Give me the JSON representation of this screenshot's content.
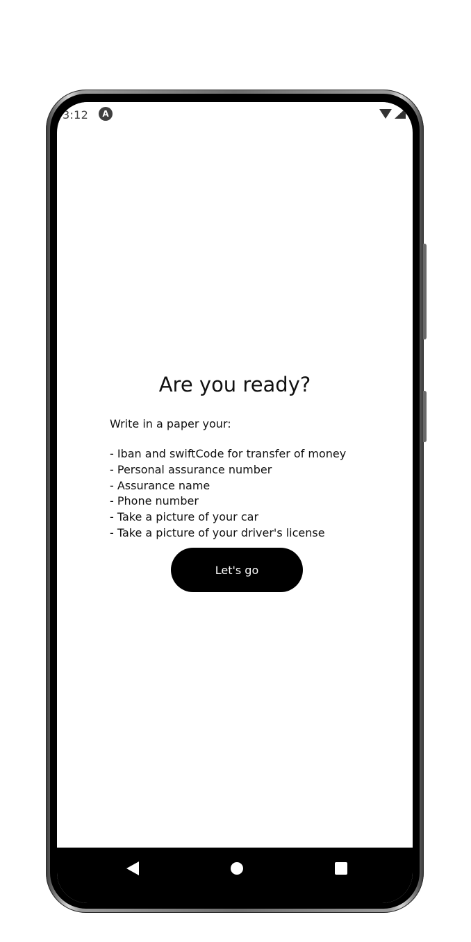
{
  "status_bar": {
    "time": "3:12",
    "notification_icon": "A",
    "icons": [
      "wifi-icon",
      "signal-icon"
    ]
  },
  "main": {
    "title": "Are you ready?",
    "intro": "Write in a paper your:",
    "items": [
      "- Iban and swiftCode for transfer of money",
      "- Personal assurance number",
      "- Assurance name",
      "- Phone number",
      "- Take a picture of your car",
      "- Take a picture of your driver's license"
    ],
    "button_label": "Let's go"
  },
  "nav_bar": {
    "icons": [
      "back-icon",
      "home-icon",
      "recents-icon"
    ]
  },
  "colors": {
    "button_bg": "#000000",
    "button_text": "#ffffff",
    "text": "#111111",
    "background": "#ffffff"
  }
}
